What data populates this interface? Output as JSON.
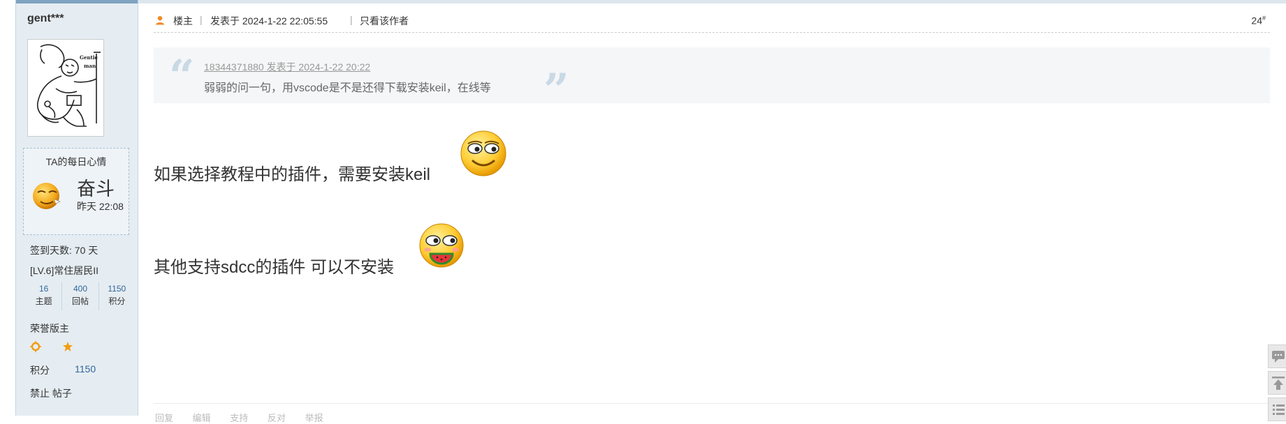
{
  "user": {
    "name": "gent***",
    "mood_title": "TA的每日心情",
    "mood_word": "奋斗",
    "mood_time": "昨天 22:08",
    "checkin": "签到天数: 70 天",
    "level": "[LV.6]常住居民II",
    "stats": [
      {
        "num": "16",
        "label": "主题"
      },
      {
        "num": "400",
        "label": "回帖"
      },
      {
        "num": "1150",
        "label": "积分"
      }
    ],
    "honor": "荣誉版主",
    "score_label": "积分",
    "score_value": "1150",
    "ban_posts": "禁止 帖子"
  },
  "post": {
    "role": "楼主",
    "date": "发表于 2024-1-22 22:05:55",
    "only_author": "只看该作者",
    "floor": "24",
    "floor_suffix": "#"
  },
  "quote": {
    "author_line": "18344371880 发表于 2024-1-22 20:22",
    "text": "弱弱的问一句，用vscode是不是还得下载安装keil，在线等"
  },
  "content": {
    "line1": "如果选择教程中的插件，需要安装keil",
    "line2": "其他支持sdcc的插件 可以不安装"
  },
  "actions": [
    "回复",
    "编辑",
    "支持",
    "反对",
    "举报"
  ],
  "icons": {
    "user": "user-icon",
    "medals": [
      "sun-medal-icon",
      "moon-medal-icon",
      "star-medal-icon"
    ],
    "emoji1": "smirk-emoji-icon",
    "emoji2": "watermelon-emoji-icon",
    "mood": "struggle-face-icon"
  },
  "colors": {
    "sidebar_bg": "#e5edf2",
    "accent_blue": "#336699",
    "medal_orange": "#f29c11"
  }
}
